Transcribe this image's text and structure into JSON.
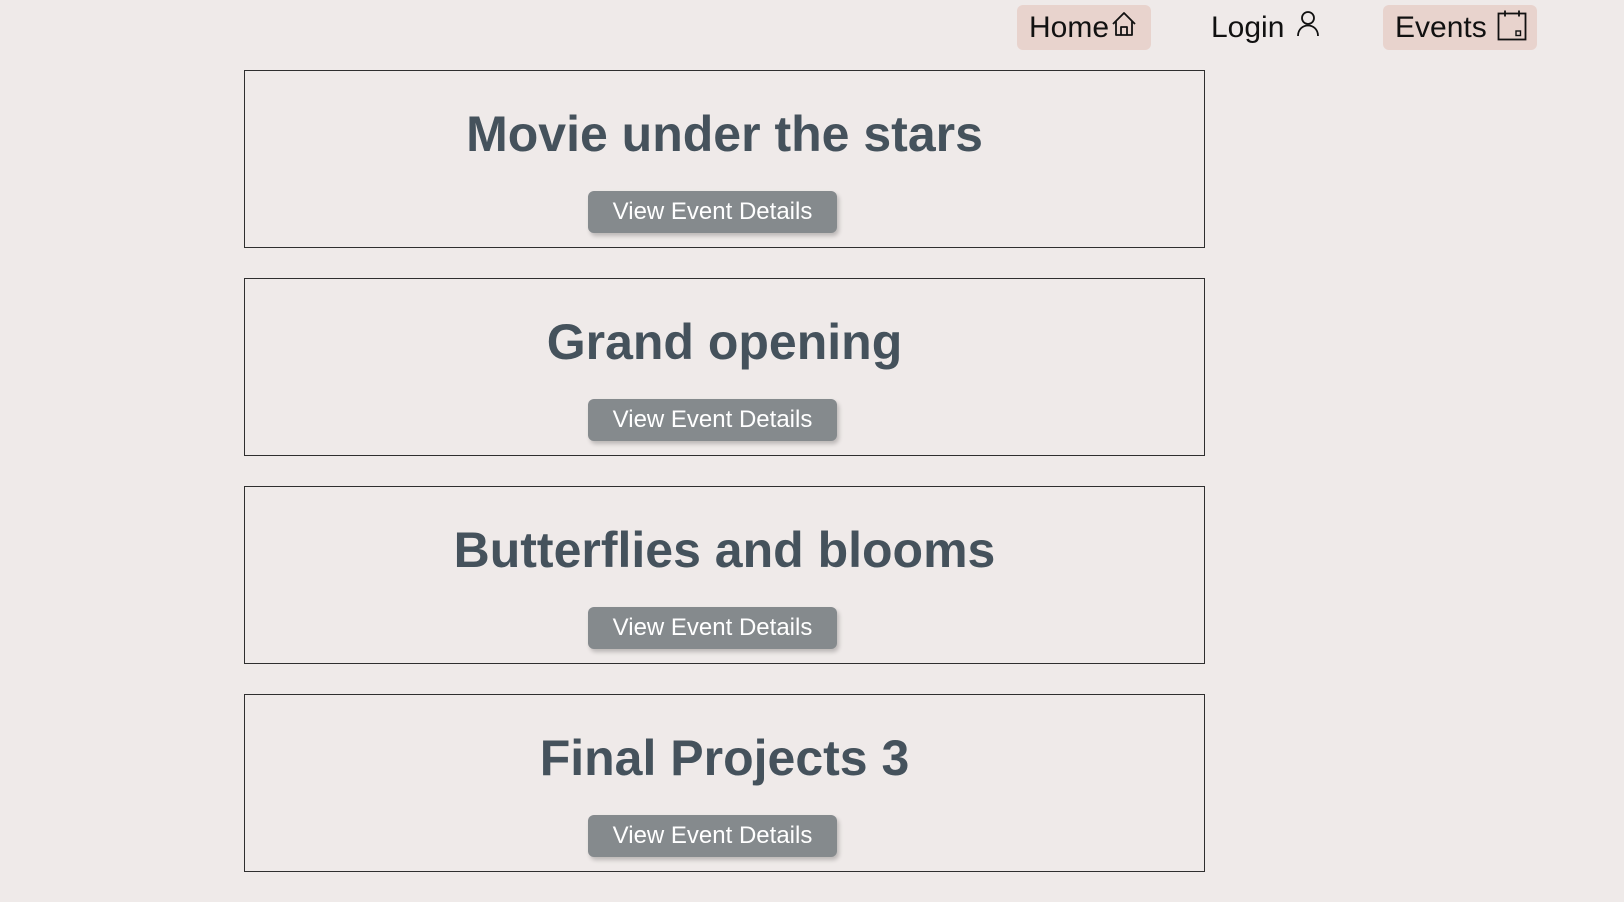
{
  "nav": {
    "items": [
      {
        "label": "Home",
        "icon": "home-icon"
      },
      {
        "label": "Login",
        "icon": "user-icon"
      },
      {
        "label": "Events",
        "icon": "calendar-icon"
      }
    ]
  },
  "events": [
    {
      "title": "Movie under the stars",
      "button_label": "View Event Details"
    },
    {
      "title": "Grand opening",
      "button_label": "View Event Details"
    },
    {
      "title": "Butterflies and blooms",
      "button_label": "View Event Details"
    },
    {
      "title": "Final Projects 3",
      "button_label": "View Event Details"
    }
  ],
  "colors": {
    "page_background": "#efeae9",
    "nav_highlight": "#e8d3cd",
    "title_text": "#45525c",
    "button_background": "#858a8d",
    "button_text": "#ffffff"
  }
}
